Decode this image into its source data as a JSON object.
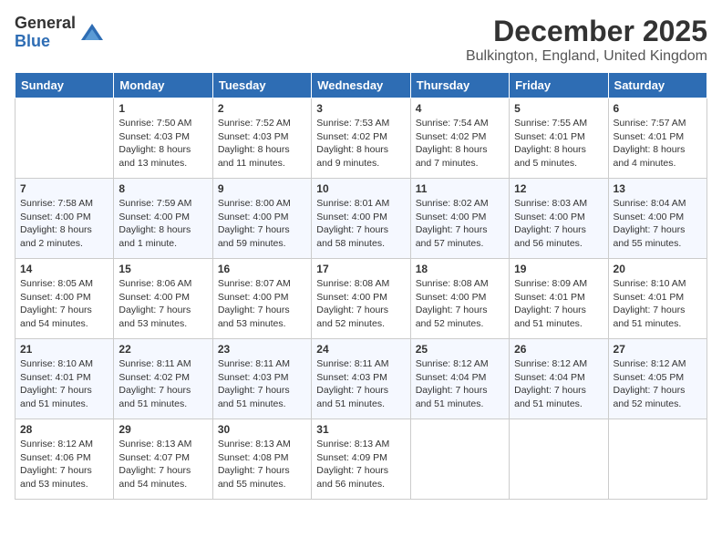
{
  "logo": {
    "general": "General",
    "blue": "Blue"
  },
  "title": "December 2025",
  "subtitle": "Bulkington, England, United Kingdom",
  "days_of_week": [
    "Sunday",
    "Monday",
    "Tuesday",
    "Wednesday",
    "Thursday",
    "Friday",
    "Saturday"
  ],
  "weeks": [
    [
      {
        "day": "",
        "info": ""
      },
      {
        "day": "1",
        "info": "Sunrise: 7:50 AM\nSunset: 4:03 PM\nDaylight: 8 hours and 13 minutes."
      },
      {
        "day": "2",
        "info": "Sunrise: 7:52 AM\nSunset: 4:03 PM\nDaylight: 8 hours and 11 minutes."
      },
      {
        "day": "3",
        "info": "Sunrise: 7:53 AM\nSunset: 4:02 PM\nDaylight: 8 hours and 9 minutes."
      },
      {
        "day": "4",
        "info": "Sunrise: 7:54 AM\nSunset: 4:02 PM\nDaylight: 8 hours and 7 minutes."
      },
      {
        "day": "5",
        "info": "Sunrise: 7:55 AM\nSunset: 4:01 PM\nDaylight: 8 hours and 5 minutes."
      },
      {
        "day": "6",
        "info": "Sunrise: 7:57 AM\nSunset: 4:01 PM\nDaylight: 8 hours and 4 minutes."
      }
    ],
    [
      {
        "day": "7",
        "info": "Sunrise: 7:58 AM\nSunset: 4:00 PM\nDaylight: 8 hours and 2 minutes."
      },
      {
        "day": "8",
        "info": "Sunrise: 7:59 AM\nSunset: 4:00 PM\nDaylight: 8 hours and 1 minute."
      },
      {
        "day": "9",
        "info": "Sunrise: 8:00 AM\nSunset: 4:00 PM\nDaylight: 7 hours and 59 minutes."
      },
      {
        "day": "10",
        "info": "Sunrise: 8:01 AM\nSunset: 4:00 PM\nDaylight: 7 hours and 58 minutes."
      },
      {
        "day": "11",
        "info": "Sunrise: 8:02 AM\nSunset: 4:00 PM\nDaylight: 7 hours and 57 minutes."
      },
      {
        "day": "12",
        "info": "Sunrise: 8:03 AM\nSunset: 4:00 PM\nDaylight: 7 hours and 56 minutes."
      },
      {
        "day": "13",
        "info": "Sunrise: 8:04 AM\nSunset: 4:00 PM\nDaylight: 7 hours and 55 minutes."
      }
    ],
    [
      {
        "day": "14",
        "info": "Sunrise: 8:05 AM\nSunset: 4:00 PM\nDaylight: 7 hours and 54 minutes."
      },
      {
        "day": "15",
        "info": "Sunrise: 8:06 AM\nSunset: 4:00 PM\nDaylight: 7 hours and 53 minutes."
      },
      {
        "day": "16",
        "info": "Sunrise: 8:07 AM\nSunset: 4:00 PM\nDaylight: 7 hours and 53 minutes."
      },
      {
        "day": "17",
        "info": "Sunrise: 8:08 AM\nSunset: 4:00 PM\nDaylight: 7 hours and 52 minutes."
      },
      {
        "day": "18",
        "info": "Sunrise: 8:08 AM\nSunset: 4:00 PM\nDaylight: 7 hours and 52 minutes."
      },
      {
        "day": "19",
        "info": "Sunrise: 8:09 AM\nSunset: 4:01 PM\nDaylight: 7 hours and 51 minutes."
      },
      {
        "day": "20",
        "info": "Sunrise: 8:10 AM\nSunset: 4:01 PM\nDaylight: 7 hours and 51 minutes."
      }
    ],
    [
      {
        "day": "21",
        "info": "Sunrise: 8:10 AM\nSunset: 4:01 PM\nDaylight: 7 hours and 51 minutes."
      },
      {
        "day": "22",
        "info": "Sunrise: 8:11 AM\nSunset: 4:02 PM\nDaylight: 7 hours and 51 minutes."
      },
      {
        "day": "23",
        "info": "Sunrise: 8:11 AM\nSunset: 4:03 PM\nDaylight: 7 hours and 51 minutes."
      },
      {
        "day": "24",
        "info": "Sunrise: 8:11 AM\nSunset: 4:03 PM\nDaylight: 7 hours and 51 minutes."
      },
      {
        "day": "25",
        "info": "Sunrise: 8:12 AM\nSunset: 4:04 PM\nDaylight: 7 hours and 51 minutes."
      },
      {
        "day": "26",
        "info": "Sunrise: 8:12 AM\nSunset: 4:04 PM\nDaylight: 7 hours and 51 minutes."
      },
      {
        "day": "27",
        "info": "Sunrise: 8:12 AM\nSunset: 4:05 PM\nDaylight: 7 hours and 52 minutes."
      }
    ],
    [
      {
        "day": "28",
        "info": "Sunrise: 8:12 AM\nSunset: 4:06 PM\nDaylight: 7 hours and 53 minutes."
      },
      {
        "day": "29",
        "info": "Sunrise: 8:13 AM\nSunset: 4:07 PM\nDaylight: 7 hours and 54 minutes."
      },
      {
        "day": "30",
        "info": "Sunrise: 8:13 AM\nSunset: 4:08 PM\nDaylight: 7 hours and 55 minutes."
      },
      {
        "day": "31",
        "info": "Sunrise: 8:13 AM\nSunset: 4:09 PM\nDaylight: 7 hours and 56 minutes."
      },
      {
        "day": "",
        "info": ""
      },
      {
        "day": "",
        "info": ""
      },
      {
        "day": "",
        "info": ""
      }
    ]
  ]
}
